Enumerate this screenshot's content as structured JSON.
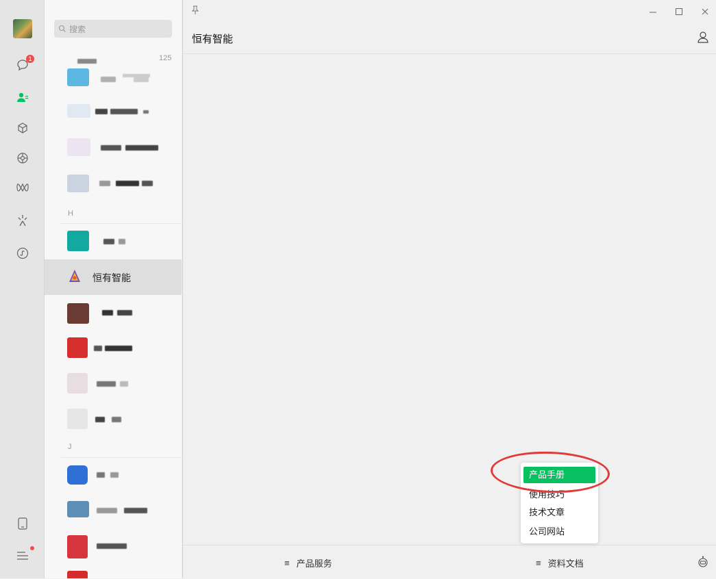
{
  "nav": {
    "unread_count": "1",
    "icons": [
      "chat-icon",
      "contacts-icon",
      "favorites-icon",
      "moments-icon",
      "channels-icon",
      "search-icon",
      "mini-programs-icon",
      "phone-icon",
      "menu-icon"
    ]
  },
  "contacts": {
    "search_placeholder": "搜索",
    "count": "125",
    "sections": [
      "H",
      "J"
    ],
    "selected_name": "恒有智能"
  },
  "window": {
    "title": "恒有智能",
    "bottom_tabs": [
      {
        "icon": "≡",
        "label": "产品服务"
      },
      {
        "icon": "≡",
        "label": "资料文档"
      }
    ],
    "dropdown": [
      "产品手册",
      "使用技巧",
      "技术文章",
      "公司网站"
    ]
  },
  "colors": {
    "accent": "#07c160",
    "highlight_ring": "#e03a3a",
    "badge": "#f24b4b"
  }
}
